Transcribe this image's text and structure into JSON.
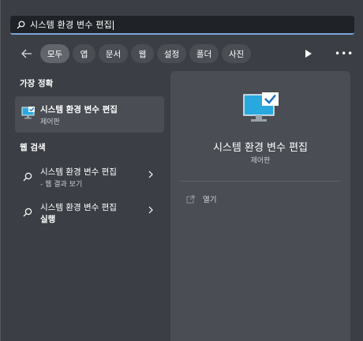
{
  "search": {
    "query": "시스템 환경 변수 편집",
    "icon": "search-icon"
  },
  "filters": {
    "chips": [
      "모두",
      "앱",
      "문서",
      "웹",
      "설정",
      "폴더",
      "사진"
    ],
    "active_index": 0
  },
  "best_match": {
    "heading": "가장 정확",
    "title": "시스템 환경 변수 편집",
    "subtitle": "제어판"
  },
  "web_search": {
    "heading": "웹 검색",
    "items": [
      {
        "title": "시스템 환경 변수 편집",
        "subtitle": "- 웹 결과 보기"
      },
      {
        "title": "시스템 환경 변수 편집",
        "subtitle": "실행"
      }
    ]
  },
  "detail": {
    "title": "시스템 환경 변수 편집",
    "subtitle": "제어판",
    "actions": [
      {
        "label": "열기",
        "icon": "open-icon"
      }
    ]
  },
  "colors": {
    "background": "#3b3f45",
    "panel": "#4a4e54",
    "search_box": "#1f2226",
    "accent": "#7aa7d8",
    "monitor_blue": "#29a8e0"
  }
}
